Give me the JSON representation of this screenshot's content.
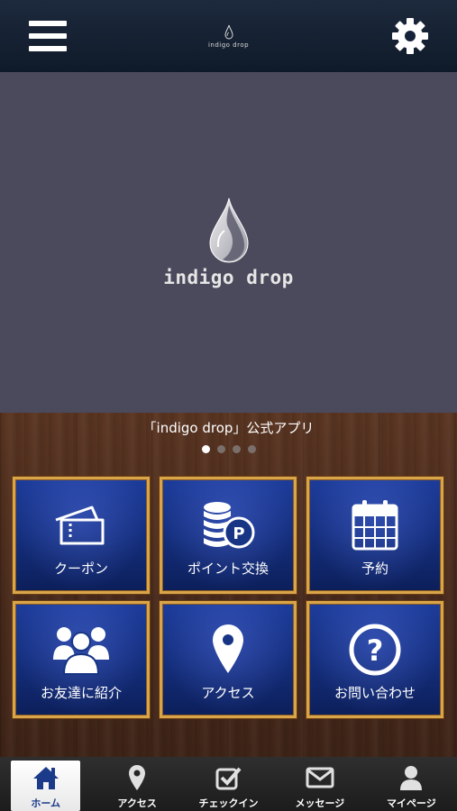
{
  "header": {
    "logo_text": "indigo drop",
    "menu_icon": "hamburger-icon",
    "settings_icon": "gear-icon"
  },
  "hero": {
    "brand": "indigo drop",
    "logo_icon": "water-drop-logo"
  },
  "caption": "「indigo drop」公式アプリ",
  "carousel": {
    "count": 4,
    "active": 0
  },
  "tiles": [
    {
      "label": "クーポン",
      "icon": "ticket-icon"
    },
    {
      "label": "ポイント交換",
      "icon": "coins-icon"
    },
    {
      "label": "予約",
      "icon": "calendar-icon"
    },
    {
      "label": "お友達に紹介",
      "icon": "group-icon"
    },
    {
      "label": "アクセス",
      "icon": "map-pin-icon"
    },
    {
      "label": "お問い合わせ",
      "icon": "question-icon"
    }
  ],
  "tabbar": [
    {
      "label": "ホーム",
      "icon": "home-icon",
      "active": true
    },
    {
      "label": "アクセス",
      "icon": "map-pin-icon",
      "active": false
    },
    {
      "label": "チェックイン",
      "icon": "checkbox-icon",
      "active": false
    },
    {
      "label": "メッセージ",
      "icon": "envelope-icon",
      "active": false
    },
    {
      "label": "マイページ",
      "icon": "user-icon",
      "active": false
    }
  ],
  "colors": {
    "header_bg": "#16223a",
    "hero_bg": "#4a4a5c",
    "tile_blue": "#1a3690",
    "tile_border": "#d9a54a",
    "active_tab_label": "#1b3a8a"
  }
}
